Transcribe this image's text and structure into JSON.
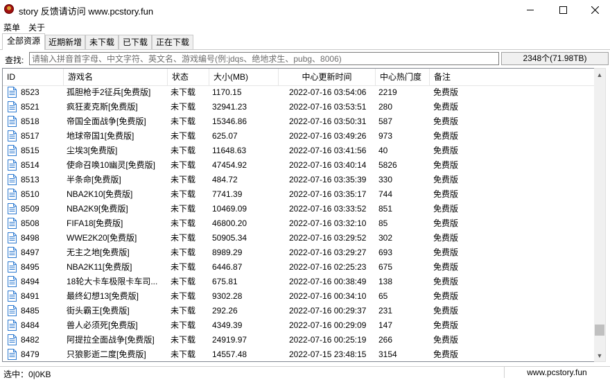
{
  "window": {
    "title": "story 反馈请访问 www.pcstory.fun"
  },
  "menu": {
    "items": [
      "菜单",
      "关于"
    ]
  },
  "tabs": [
    "全部资源",
    "近期新增",
    "未下载",
    "已下载",
    "正在下载"
  ],
  "search": {
    "label": "查找:",
    "placeholder": "请输入拼音首字母、中文字符、英文名、游戏编号(例:jdqs、绝地求生、pubg、8006)",
    "value": ""
  },
  "summary": {
    "count_text": "2348个(71.98TB)"
  },
  "columns": [
    "ID",
    "游戏名",
    "状态",
    "大小(MB)",
    "中心更新时间",
    "中心热门度",
    "备注"
  ],
  "rows": [
    [
      "8523",
      "孤胆枪手2征兵[免费版]",
      "未下载",
      "1170.15",
      "2022-07-16 03:54:06",
      "2219",
      "免费版"
    ],
    [
      "8521",
      "疯狂麦克斯[免费版]",
      "未下载",
      "32941.23",
      "2022-07-16 03:53:51",
      "280",
      "免费版"
    ],
    [
      "8518",
      "帝国全面战争[免费版]",
      "未下载",
      "15346.86",
      "2022-07-16 03:50:31",
      "587",
      "免费版"
    ],
    [
      "8517",
      "地球帝国1[免费版]",
      "未下载",
      "625.07",
      "2022-07-16 03:49:26",
      "973",
      "免费版"
    ],
    [
      "8515",
      "尘埃3[免费版]",
      "未下载",
      "11648.63",
      "2022-07-16 03:41:56",
      "40",
      "免费版"
    ],
    [
      "8514",
      "使命召唤10幽灵[免费版]",
      "未下载",
      "47454.92",
      "2022-07-16 03:40:14",
      "5826",
      "免费版"
    ],
    [
      "8513",
      "半条命[免费版]",
      "未下载",
      "484.72",
      "2022-07-16 03:35:39",
      "330",
      "免费版"
    ],
    [
      "8510",
      "NBA2K10[免费版]",
      "未下载",
      "7741.39",
      "2022-07-16 03:35:17",
      "744",
      "免费版"
    ],
    [
      "8509",
      "NBA2K9[免费版]",
      "未下载",
      "10469.09",
      "2022-07-16 03:33:52",
      "851",
      "免费版"
    ],
    [
      "8508",
      "FIFA18[免费版]",
      "未下载",
      "46800.20",
      "2022-07-16 03:32:10",
      "85",
      "免费版"
    ],
    [
      "8498",
      "WWE2K20[免费版]",
      "未下载",
      "50905.34",
      "2022-07-16 03:29:52",
      "302",
      "免费版"
    ],
    [
      "8497",
      "无主之地[免费版]",
      "未下载",
      "8989.29",
      "2022-07-16 03:29:27",
      "693",
      "免费版"
    ],
    [
      "8495",
      "NBA2K11[免费版]",
      "未下载",
      "6446.87",
      "2022-07-16 02:25:23",
      "675",
      "免费版"
    ],
    [
      "8494",
      "18轮大卡车极限卡车司...",
      "未下载",
      "675.81",
      "2022-07-16 00:38:49",
      "138",
      "免费版"
    ],
    [
      "8491",
      "最终幻想13[免费版]",
      "未下载",
      "9302.28",
      "2022-07-16 00:34:10",
      "65",
      "免费版"
    ],
    [
      "8485",
      "街头霸王[免费版]",
      "未下载",
      "292.26",
      "2022-07-16 00:29:37",
      "231",
      "免费版"
    ],
    [
      "8484",
      "兽人必须死[免费版]",
      "未下载",
      "4349.39",
      "2022-07-16 00:29:09",
      "147",
      "免费版"
    ],
    [
      "8482",
      "阿提拉全面战争[免费版]",
      "未下载",
      "24919.97",
      "2022-07-16 00:25:19",
      "266",
      "免费版"
    ],
    [
      "8479",
      "只狼影逝二度[免费版]",
      "未下载",
      "14557.48",
      "2022-07-15 23:48:15",
      "3154",
      "免费版"
    ]
  ],
  "scrollbar": {
    "position_fraction": 0.94
  },
  "status": {
    "selected_text": "选中：0|0KB",
    "website": "www.pcstory.fun"
  },
  "icons": {
    "app": "app-logo-icon",
    "row": "document-icon"
  },
  "colors": {
    "row_icon": "#2a78d0",
    "background": "#ffffff",
    "chrome": "#f0f0f0"
  }
}
